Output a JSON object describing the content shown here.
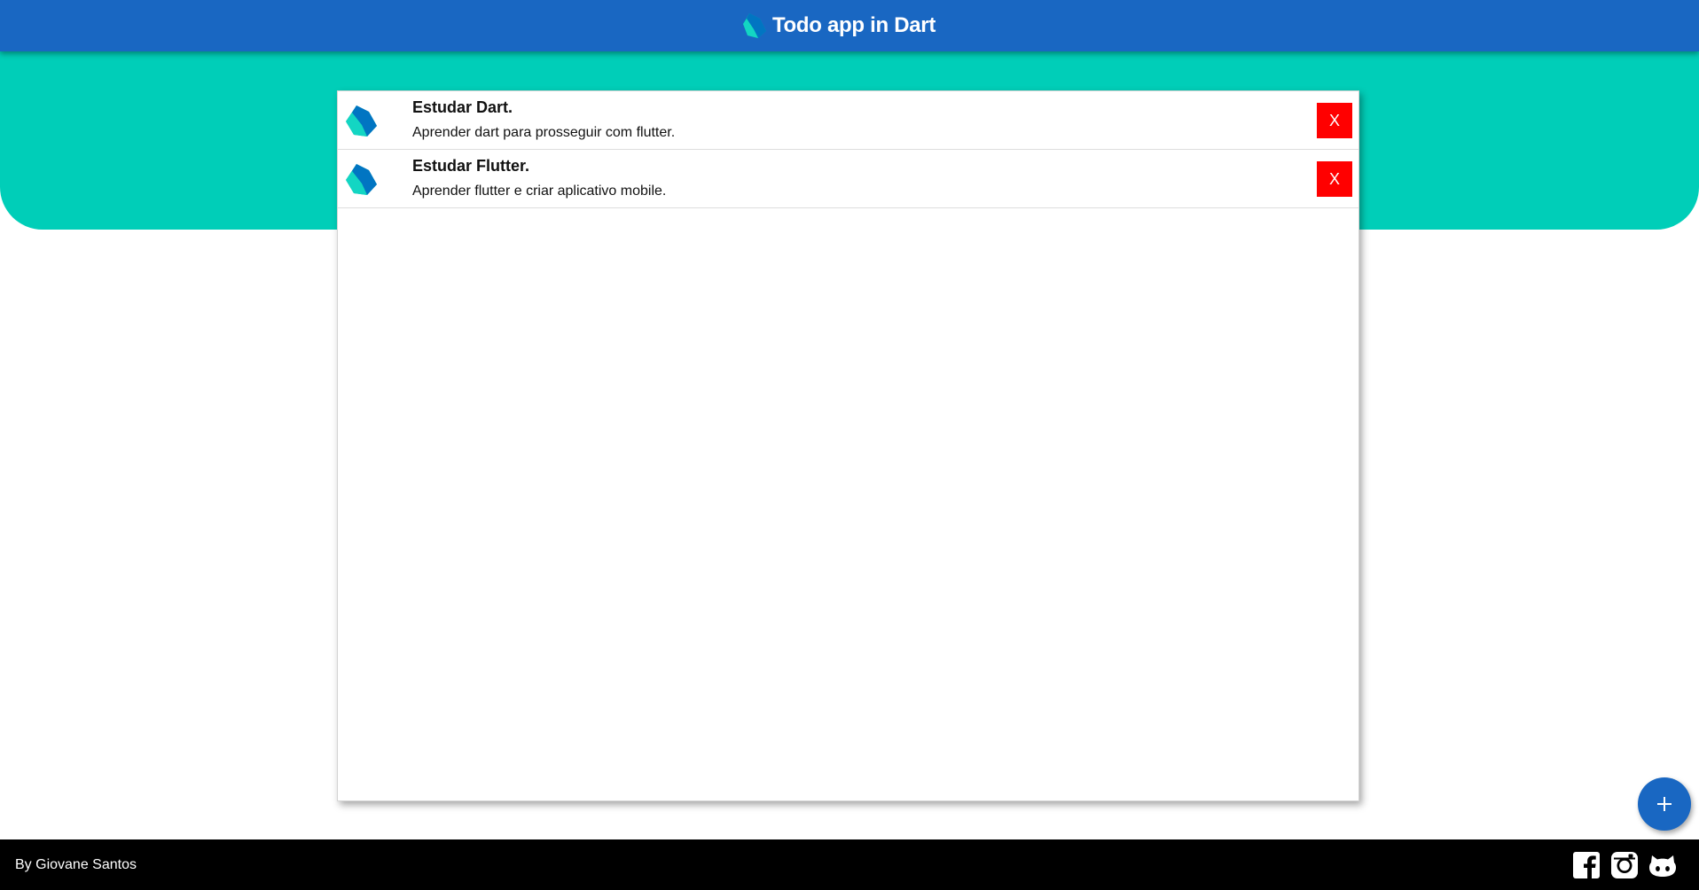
{
  "header": {
    "title": "Todo app in Dart",
    "logo_icon": "dart-logo-icon",
    "background": "#1967c2"
  },
  "banner": {
    "background": "#00ceb8"
  },
  "todos": [
    {
      "title": "Estudar Dart.",
      "description": "Aprender dart para prosseguir com flutter.",
      "icon": "dart-logo-icon",
      "delete_label": "X"
    },
    {
      "title": "Estudar Flutter.",
      "description": "Aprender flutter e criar aplicativo mobile.",
      "icon": "dart-logo-icon",
      "delete_label": "X"
    }
  ],
  "fab": {
    "icon": "plus-icon",
    "color": "#1967c2"
  },
  "footer": {
    "credit": "By Giovane Santos",
    "social": [
      {
        "name": "facebook",
        "icon": "facebook-icon"
      },
      {
        "name": "instagram",
        "icon": "instagram-icon"
      },
      {
        "name": "github",
        "icon": "github-icon"
      }
    ]
  },
  "colors": {
    "delete_button": "#ff0000",
    "footer_bg": "#000000"
  }
}
